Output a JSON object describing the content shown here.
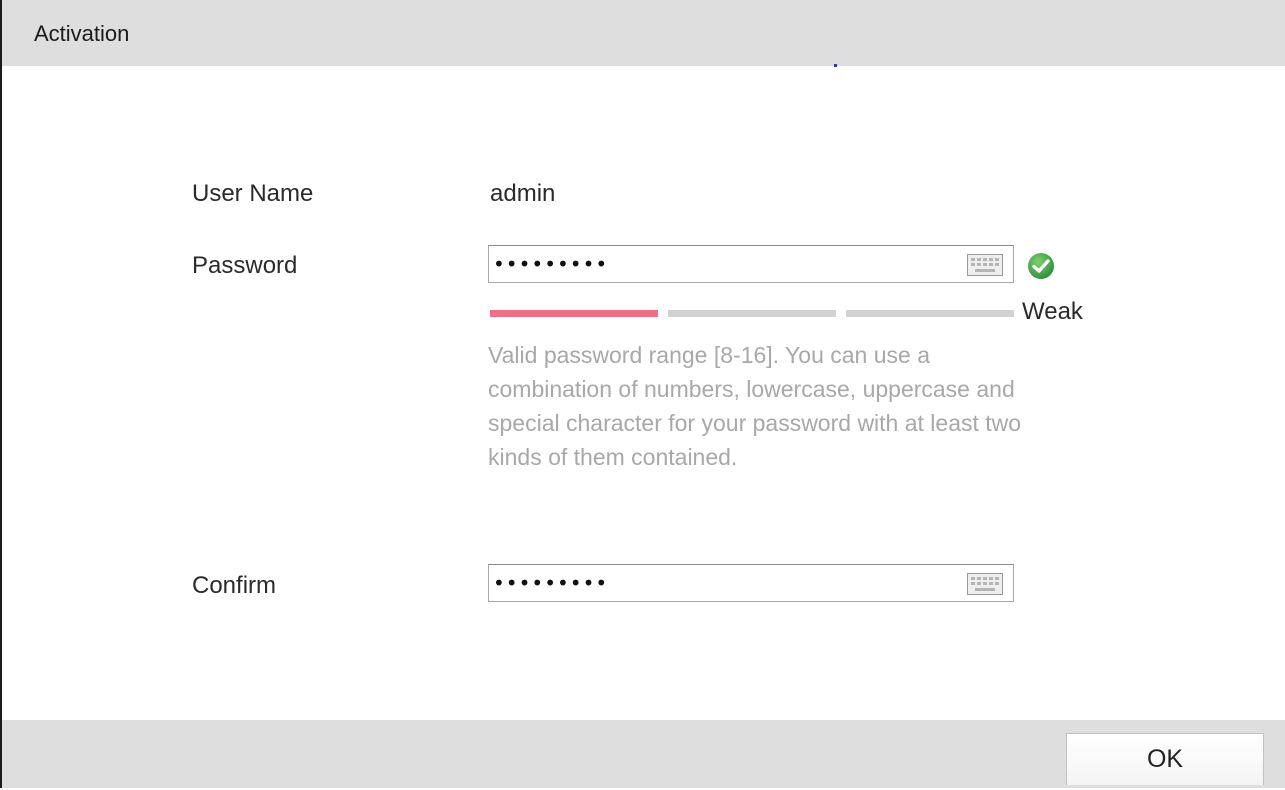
{
  "dialog": {
    "title": "Activation"
  },
  "form": {
    "username_label": "User Name",
    "username_value": "admin",
    "password_label": "Password",
    "password_value": "•••••••••",
    "confirm_label": "Confirm",
    "confirm_value": "•••••••••",
    "keyboard_icon": "keyboard-icon",
    "valid_icon": "check-circle-icon"
  },
  "strength": {
    "label": "Weak",
    "level_segments_filled": 1,
    "segments_total": 3,
    "colors": {
      "filled": "#f06e86",
      "empty": "#d2d2d2"
    }
  },
  "hint": {
    "text": "Valid password range [8-16]. You can use a combination of numbers, lowercase, uppercase and special character for your password with at least two kinds of them contained."
  },
  "footer": {
    "ok_label": "OK"
  },
  "colors": {
    "titlebar_bg": "#dedede",
    "hint_text": "#a8a8a8",
    "valid_green": "#3aa34a"
  }
}
